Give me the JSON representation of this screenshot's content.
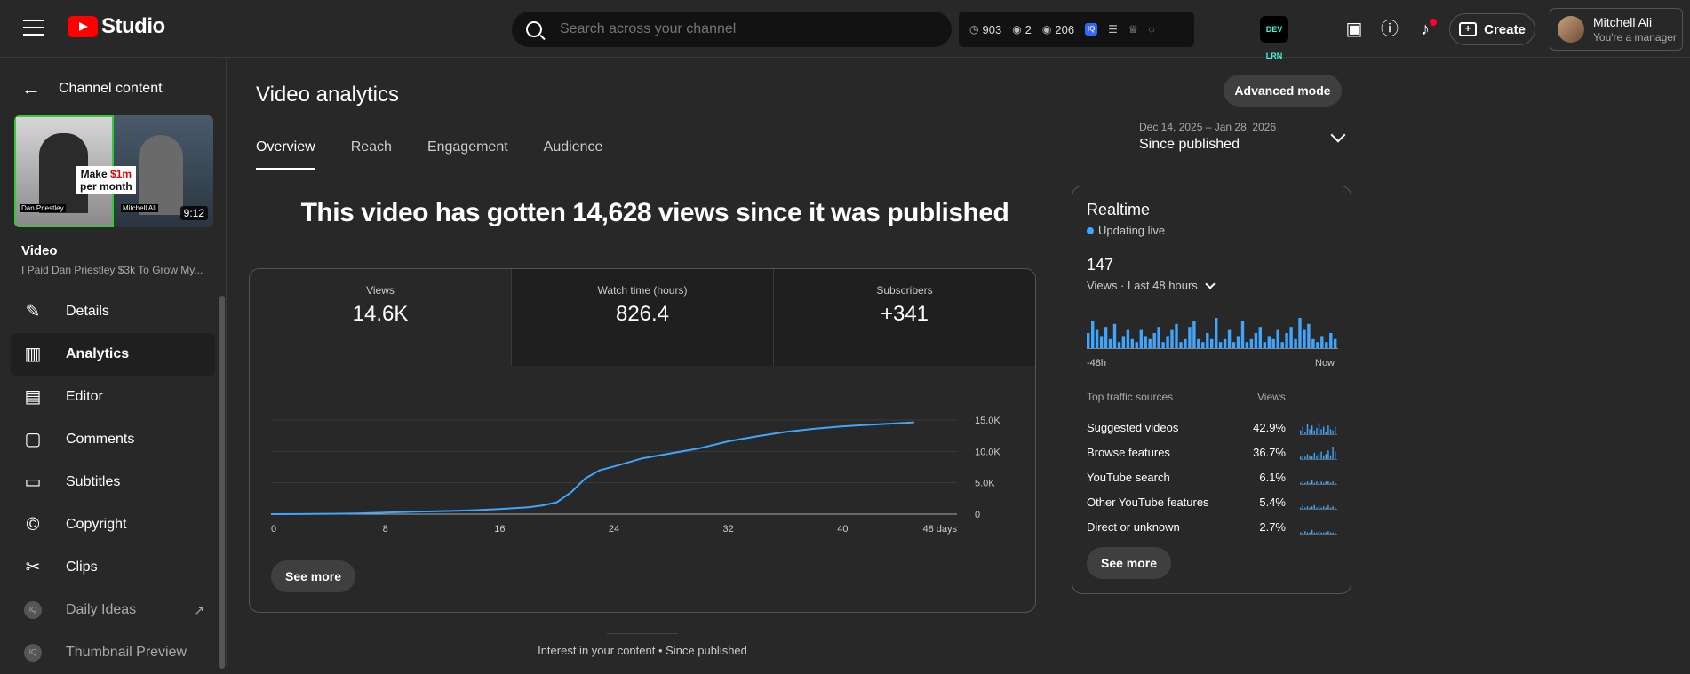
{
  "app": {
    "brand": "Studio",
    "search_placeholder": "Search across your channel"
  },
  "stats": {
    "watch": "903",
    "views_now": "2",
    "views_48h": "206",
    "badge": "IQ"
  },
  "ext_icon_label": "DEV LRN",
  "header": {
    "create_label": "Create",
    "account_name": "Mitchell Ali",
    "account_role": "You're a manager"
  },
  "sidebar": {
    "back_label": "Channel content",
    "thumb_tag_line1": "Make ",
    "thumb_tag_red": "$1m",
    "thumb_tag_line2": "per month",
    "thumb_caption_left": "Dan Priestley",
    "thumb_caption_right": "Mitchell Ali",
    "thumb_duration": "9:12",
    "video_label": "Video",
    "video_title": "I Paid Dan Priestley $3k To Grow My...",
    "items": [
      {
        "label": "Details",
        "icon": "pencil-icon"
      },
      {
        "label": "Analytics",
        "icon": "analytics-icon"
      },
      {
        "label": "Editor",
        "icon": "clapper-icon"
      },
      {
        "label": "Comments",
        "icon": "comment-icon"
      },
      {
        "label": "Subtitles",
        "icon": "subtitles-icon"
      },
      {
        "label": "Copyright",
        "icon": "copyright-icon"
      },
      {
        "label": "Clips",
        "icon": "scissors-icon"
      },
      {
        "label": "Daily Ideas",
        "icon": "iq-icon"
      },
      {
        "label": "Thumbnail Preview",
        "icon": "iq-icon"
      }
    ]
  },
  "main": {
    "title": "Video analytics",
    "advanced_label": "Advanced mode",
    "tabs": [
      "Overview",
      "Reach",
      "Engagement",
      "Audience"
    ],
    "date_range": "Dec 14, 2025 – Jan 28, 2026",
    "date_preset": "Since published",
    "headline": "This video has gotten 14,628 views since it was published",
    "metrics": [
      {
        "label": "Views",
        "value": "14.6K"
      },
      {
        "label": "Watch time (hours)",
        "value": "826.4"
      },
      {
        "label": "Subscribers",
        "value": "+341"
      }
    ],
    "see_more": "See more",
    "footnote": "Interest in your content • Since published"
  },
  "chart_data": {
    "type": "line",
    "x": [
      0,
      2,
      4,
      6,
      8,
      10,
      12,
      14,
      16,
      18,
      19,
      20,
      21,
      22,
      23,
      24,
      26,
      28,
      30,
      32,
      34,
      36,
      38,
      40,
      42,
      44,
      45
    ],
    "series": [
      {
        "values": [
          0,
          20,
          60,
          120,
          250,
          380,
          480,
          600,
          800,
          1100,
          1400,
          1900,
          3500,
          5700,
          7000,
          7600,
          8900,
          9700,
          10500,
          11600,
          12400,
          13100,
          13600,
          14000,
          14250,
          14500,
          14628
        ]
      }
    ],
    "xticks": [
      "0",
      "8",
      "16",
      "24",
      "32",
      "40",
      "48 days"
    ],
    "xtick_values": [
      0,
      8,
      16,
      24,
      32,
      40,
      48
    ],
    "yticks": [
      "0",
      "5.0K",
      "10.0K",
      "15.0K"
    ],
    "ytick_values": [
      0,
      5000,
      10000,
      15000
    ],
    "xlim": [
      0,
      48
    ],
    "ylim": [
      0,
      15000
    ],
    "grid": true,
    "color": "#3ea6ff"
  },
  "realtime": {
    "title": "Realtime",
    "live_label": "Updating live",
    "count": "147",
    "subtitle": "Views · Last 48 hours",
    "axis_left": "-48h",
    "axis_right": "Now",
    "sources_header": "Top traffic sources",
    "views_header": "Views",
    "bars": [
      5,
      9,
      6,
      4,
      7,
      3,
      8,
      2,
      4,
      6,
      3,
      2,
      6,
      4,
      3,
      5,
      7,
      2,
      4,
      6,
      8,
      2,
      3,
      7,
      9,
      3,
      2,
      5,
      3,
      10,
      2,
      3,
      6,
      2,
      4,
      9,
      2,
      3,
      5,
      7,
      2,
      4,
      3,
      6,
      2,
      5,
      7,
      3,
      10,
      6,
      8,
      3,
      2,
      4,
      2,
      5,
      3
    ],
    "sources": [
      {
        "name": "Suggested videos",
        "pct": "42.9%",
        "spark": [
          3,
          6,
          2,
          8,
          4,
          7,
          3,
          5,
          9,
          4,
          6,
          2,
          7,
          4,
          3,
          6
        ]
      },
      {
        "name": "Browse features",
        "pct": "36.7%",
        "spark": [
          2,
          3,
          2,
          4,
          3,
          2,
          5,
          3,
          4,
          6,
          3,
          4,
          7,
          3,
          10,
          6
        ]
      },
      {
        "name": "YouTube search",
        "pct": "6.1%",
        "spark": [
          1,
          2,
          1,
          2,
          1,
          3,
          1,
          2,
          1,
          2,
          1,
          2,
          2,
          1,
          2,
          1
        ]
      },
      {
        "name": "Other YouTube features",
        "pct": "5.4%",
        "spark": [
          1,
          3,
          1,
          2,
          1,
          2,
          3,
          1,
          2,
          1,
          2,
          1,
          3,
          1,
          2,
          1
        ]
      },
      {
        "name": "Direct or unknown",
        "pct": "2.7%",
        "spark": [
          1,
          1,
          2,
          1,
          1,
          3,
          1,
          1,
          2,
          1,
          1,
          1,
          2,
          1,
          1,
          1
        ]
      }
    ],
    "see_more": "See more"
  }
}
